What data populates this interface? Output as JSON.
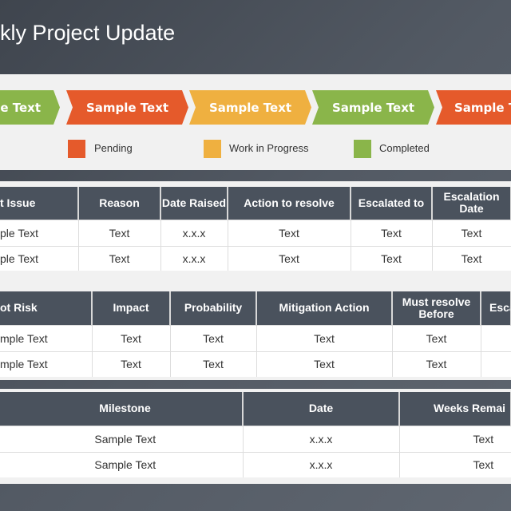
{
  "title": "kly Project Update",
  "process": {
    "steps": [
      {
        "label": "e Text",
        "status": "Completed",
        "color": "#8ab54a"
      },
      {
        "label": "Sample Text",
        "status": "Pending",
        "color": "#e55a2b"
      },
      {
        "label": "Sample Text",
        "status": "Work in Progress",
        "color": "#efb040"
      },
      {
        "label": "Sample Text",
        "status": "Completed",
        "color": "#8ab54a"
      },
      {
        "label": "Sample T",
        "status": "Pending",
        "color": "#e55a2b"
      }
    ]
  },
  "legend": [
    {
      "label": "Pending",
      "color": "#e55a2b"
    },
    {
      "label": "Work in Progress",
      "color": "#efb040"
    },
    {
      "label": "Completed",
      "color": "#8ab54a"
    }
  ],
  "issues": {
    "headers": [
      "t Issue",
      "Reason",
      "Date Raised",
      "Action to resolve",
      "Escalated to",
      "Escalation Date"
    ],
    "rows": [
      [
        "ple Text",
        "Text",
        "x.x.x",
        "Text",
        "Text",
        "Text"
      ],
      [
        "ple Text",
        "Text",
        "x.x.x",
        "Text",
        "Text",
        "Text"
      ]
    ]
  },
  "risks": {
    "headers": [
      "ot Risk",
      "Impact",
      "Probability",
      "Mitigation Action",
      "Must resolve Before",
      "Esca"
    ],
    "rows": [
      [
        "mple Text",
        "Text",
        "Text",
        "Text",
        "Text",
        ""
      ],
      [
        "mple Text",
        "Text",
        "Text",
        "Text",
        "Text",
        ""
      ]
    ]
  },
  "milestones": {
    "headers": [
      "Milestone",
      "Date",
      "Weeks Remai"
    ],
    "rows": [
      [
        "Sample Text",
        "x.x.x",
        "Text"
      ],
      [
        "Sample Text",
        "x.x.x",
        "Text"
      ]
    ]
  }
}
